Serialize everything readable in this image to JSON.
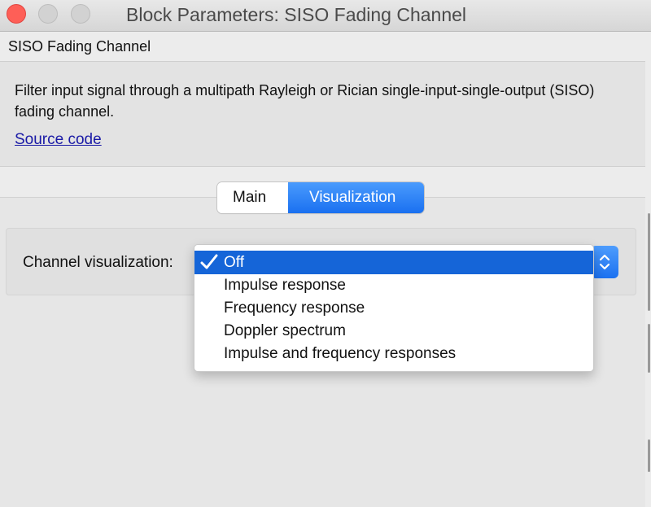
{
  "window": {
    "title": "Block Parameters: SISO Fading Channel"
  },
  "block": {
    "name": "SISO Fading Channel",
    "description": "Filter input signal through a multipath Rayleigh or Rician single-input-single-output (SISO) fading channel.",
    "source_link": "Source code"
  },
  "tabs": [
    {
      "label": "Main",
      "active": false
    },
    {
      "label": "Visualization",
      "active": true
    }
  ],
  "parameter": {
    "label": "Channel visualization:",
    "selected_value": "Off",
    "options": [
      "Off",
      "Impulse response",
      "Frequency response",
      "Doppler spectrum",
      "Impulse and frequency responses"
    ]
  },
  "colors": {
    "accent": "#1a70f0",
    "selection": "#1565d8",
    "close_button": "#fe5f57",
    "link": "#1a1aa6"
  },
  "icons": {
    "close": "close-icon",
    "minimize": "minimize-icon",
    "maximize": "maximize-icon",
    "check": "checkmark-icon",
    "select_arrows": "chevron-updown-icon"
  }
}
